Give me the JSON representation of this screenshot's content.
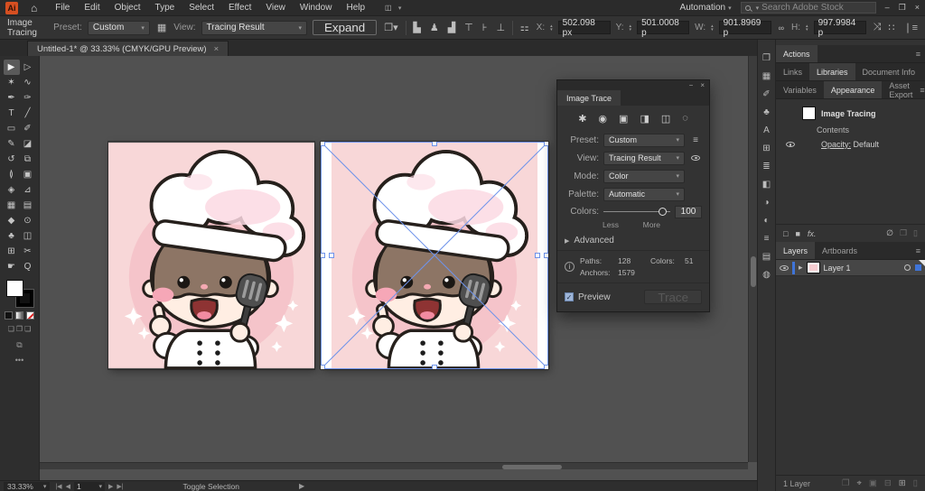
{
  "window": {
    "minimize": "–",
    "restore": "❐",
    "close": "×"
  },
  "menubar": {
    "logo": "Ai",
    "home_icon": "⌂",
    "items": [
      {
        "name": "menu-file",
        "label": "File"
      },
      {
        "name": "menu-edit",
        "label": "Edit"
      },
      {
        "name": "menu-object",
        "label": "Object"
      },
      {
        "name": "menu-type",
        "label": "Type"
      },
      {
        "name": "menu-select",
        "label": "Select"
      },
      {
        "name": "menu-effect",
        "label": "Effect"
      },
      {
        "name": "menu-view",
        "label": "View"
      },
      {
        "name": "menu-window",
        "label": "Window"
      },
      {
        "name": "menu-help",
        "label": "Help"
      }
    ],
    "workspace_value": "Automation",
    "search_placeholder": "Search Adobe Stock"
  },
  "controlbar": {
    "context_label": "Image Tracing",
    "preset_label": "Preset:",
    "preset_value": "Custom",
    "view_label": "View:",
    "view_value": "Tracing Result",
    "expand_label": "Expand",
    "x_label": "X:",
    "x_value": "502.098 px",
    "y_label": "Y:",
    "y_value": "501.0008 p",
    "w_label": "W:",
    "w_value": "901.8969 p",
    "h_label": "H:",
    "h_value": "997.9984 p"
  },
  "doc_tab": {
    "title": "Untitled-1* @ 33.33% (CMYK/GPU Preview)",
    "close": "×"
  },
  "tools": [
    {
      "name": "tool-selection",
      "glyph": "▶",
      "active": true
    },
    {
      "name": "tool-direct-selection",
      "glyph": "▷"
    },
    {
      "name": "tool-magic-wand",
      "glyph": "✶"
    },
    {
      "name": "tool-lasso",
      "glyph": "∿"
    },
    {
      "name": "tool-pen",
      "glyph": "✒"
    },
    {
      "name": "tool-curvature",
      "glyph": "✑"
    },
    {
      "name": "tool-type",
      "glyph": "T"
    },
    {
      "name": "tool-line-segment",
      "glyph": "╱"
    },
    {
      "name": "tool-rectangle",
      "glyph": "▭"
    },
    {
      "name": "tool-paintbrush",
      "glyph": "✐"
    },
    {
      "name": "tool-pencil",
      "glyph": "✎"
    },
    {
      "name": "tool-eraser",
      "glyph": "◪"
    },
    {
      "name": "tool-rotate",
      "glyph": "↺"
    },
    {
      "name": "tool-scale",
      "glyph": "⧉"
    },
    {
      "name": "tool-width",
      "glyph": "≬"
    },
    {
      "name": "tool-free-transform",
      "glyph": "▣"
    },
    {
      "name": "tool-shape-builder",
      "glyph": "◈"
    },
    {
      "name": "tool-perspective-grid",
      "glyph": "⊿"
    },
    {
      "name": "tool-mesh",
      "glyph": "▦"
    },
    {
      "name": "tool-gradient",
      "glyph": "▤"
    },
    {
      "name": "tool-eyedropper",
      "glyph": "◆"
    },
    {
      "name": "tool-blend",
      "glyph": "⊙"
    },
    {
      "name": "tool-symbol-sprayer",
      "glyph": "♣"
    },
    {
      "name": "tool-column-graph",
      "glyph": "◫"
    },
    {
      "name": "tool-artboard",
      "glyph": "⊞"
    },
    {
      "name": "tool-slice",
      "glyph": "✂"
    },
    {
      "name": "tool-hand",
      "glyph": "☛"
    },
    {
      "name": "tool-zoom",
      "glyph": "Q"
    }
  ],
  "trace_panel": {
    "title": "Image Trace",
    "minimize": "−",
    "close": "×",
    "preset_icons": [
      {
        "name": "auto-color-preset-icon",
        "glyph": "✱"
      },
      {
        "name": "high-color-preset-icon",
        "glyph": "◉"
      },
      {
        "name": "low-color-preset-icon",
        "glyph": "▣"
      },
      {
        "name": "grayscale-preset-icon",
        "glyph": "◨"
      },
      {
        "name": "black-white-preset-icon",
        "glyph": "◫"
      },
      {
        "name": "outline-preset-icon",
        "glyph": "◌"
      }
    ],
    "preset_label": "Preset:",
    "preset_value": "Custom",
    "view_label": "View:",
    "view_value": "Tracing Result",
    "mode_label": "Mode:",
    "mode_value": "Color",
    "palette_label": "Palette:",
    "palette_value": "Automatic",
    "colors_label": "Colors:",
    "colors_value": "100",
    "less_label": "Less",
    "more_label": "More",
    "advanced_label": "Advanced",
    "info_icon": "i",
    "paths_label": "Paths:",
    "paths_value": "128",
    "colors_stat_label": "Colors:",
    "colors_stat_value": "51",
    "anchors_label": "Anchors:",
    "anchors_value": "1579",
    "preview_label": "Preview",
    "preview_check": "✓",
    "trace_label": "Trace"
  },
  "strip_icons": [
    {
      "name": "artboards-collapsed-icon",
      "glyph": "❐"
    },
    {
      "name": "links-collapsed-icon",
      "glyph": "▦"
    },
    {
      "name": "brushes-collapsed-icon",
      "glyph": "✐"
    },
    {
      "name": "symbols-collapsed-icon",
      "glyph": "♣"
    },
    {
      "name": "glyphs-collapsed-icon",
      "glyph": "A"
    },
    {
      "name": "transform-collapsed-icon",
      "glyph": "⊞"
    },
    {
      "name": "align-collapsed-icon",
      "glyph": "≣"
    },
    {
      "name": "pathfinder-collapsed-icon",
      "glyph": "◧"
    },
    {
      "name": "color-collapsed-icon",
      "glyph": "◑"
    },
    {
      "name": "color-guide-collapsed-icon",
      "glyph": "◐"
    },
    {
      "name": "stroke-collapsed-icon",
      "glyph": "≡"
    },
    {
      "name": "gradient-collapsed-icon",
      "glyph": "▤"
    },
    {
      "name": "transparency-collapsed-icon",
      "glyph": "◍"
    }
  ],
  "dock": {
    "actions_tab": "Actions",
    "libraries_tabs": [
      {
        "name": "tab-links",
        "label": "Links"
      },
      {
        "name": "tab-libraries",
        "label": "Libraries",
        "active": true
      },
      {
        "name": "tab-document-info",
        "label": "Document Info"
      }
    ],
    "appearance_tabs": [
      {
        "name": "tab-variables",
        "label": "Variables"
      },
      {
        "name": "tab-appearance",
        "label": "Appearance",
        "active": true
      },
      {
        "name": "tab-asset-export",
        "label": "Asset Export"
      }
    ],
    "appearance": {
      "item_label": "Image Tracing",
      "contents_label": "Contents",
      "opacity_label": "Opacity:",
      "opacity_value": "Default",
      "stroke_icon": "□",
      "fill_icon": "■",
      "fx_label": "fx.",
      "clear_icon": "∅",
      "duplicate_icon": "❐",
      "delete_icon": "▯"
    },
    "layers_tabs": [
      {
        "name": "tab-layers",
        "label": "Layers",
        "active": true
      },
      {
        "name": "tab-artboards",
        "label": "Artboards"
      }
    ],
    "layer": {
      "expand": "▸",
      "name": "Layer 1"
    },
    "footer": {
      "count": "1 Layer",
      "collect_icon": "❐",
      "locate_icon": "⌖",
      "mask_icon": "▣",
      "sublayer_icon": "⊟",
      "new_layer_icon": "⊞",
      "delete_icon": "▯"
    }
  },
  "statusbar": {
    "zoom": "33.33%",
    "nav_first": "|◀",
    "nav_prev": "◀",
    "artboard": "1",
    "nav_next": "▶",
    "nav_last": "▶|",
    "hint": "Toggle Selection",
    "arrow": "▶"
  },
  "colors": {
    "selection_blue": "#6e93ea",
    "artwork_bg_pink": "#f8d7d8",
    "artwork_circle_pink": "#f5c4ca",
    "accent_blue": "#3f74d8",
    "logo_orange": "#d64f21"
  }
}
